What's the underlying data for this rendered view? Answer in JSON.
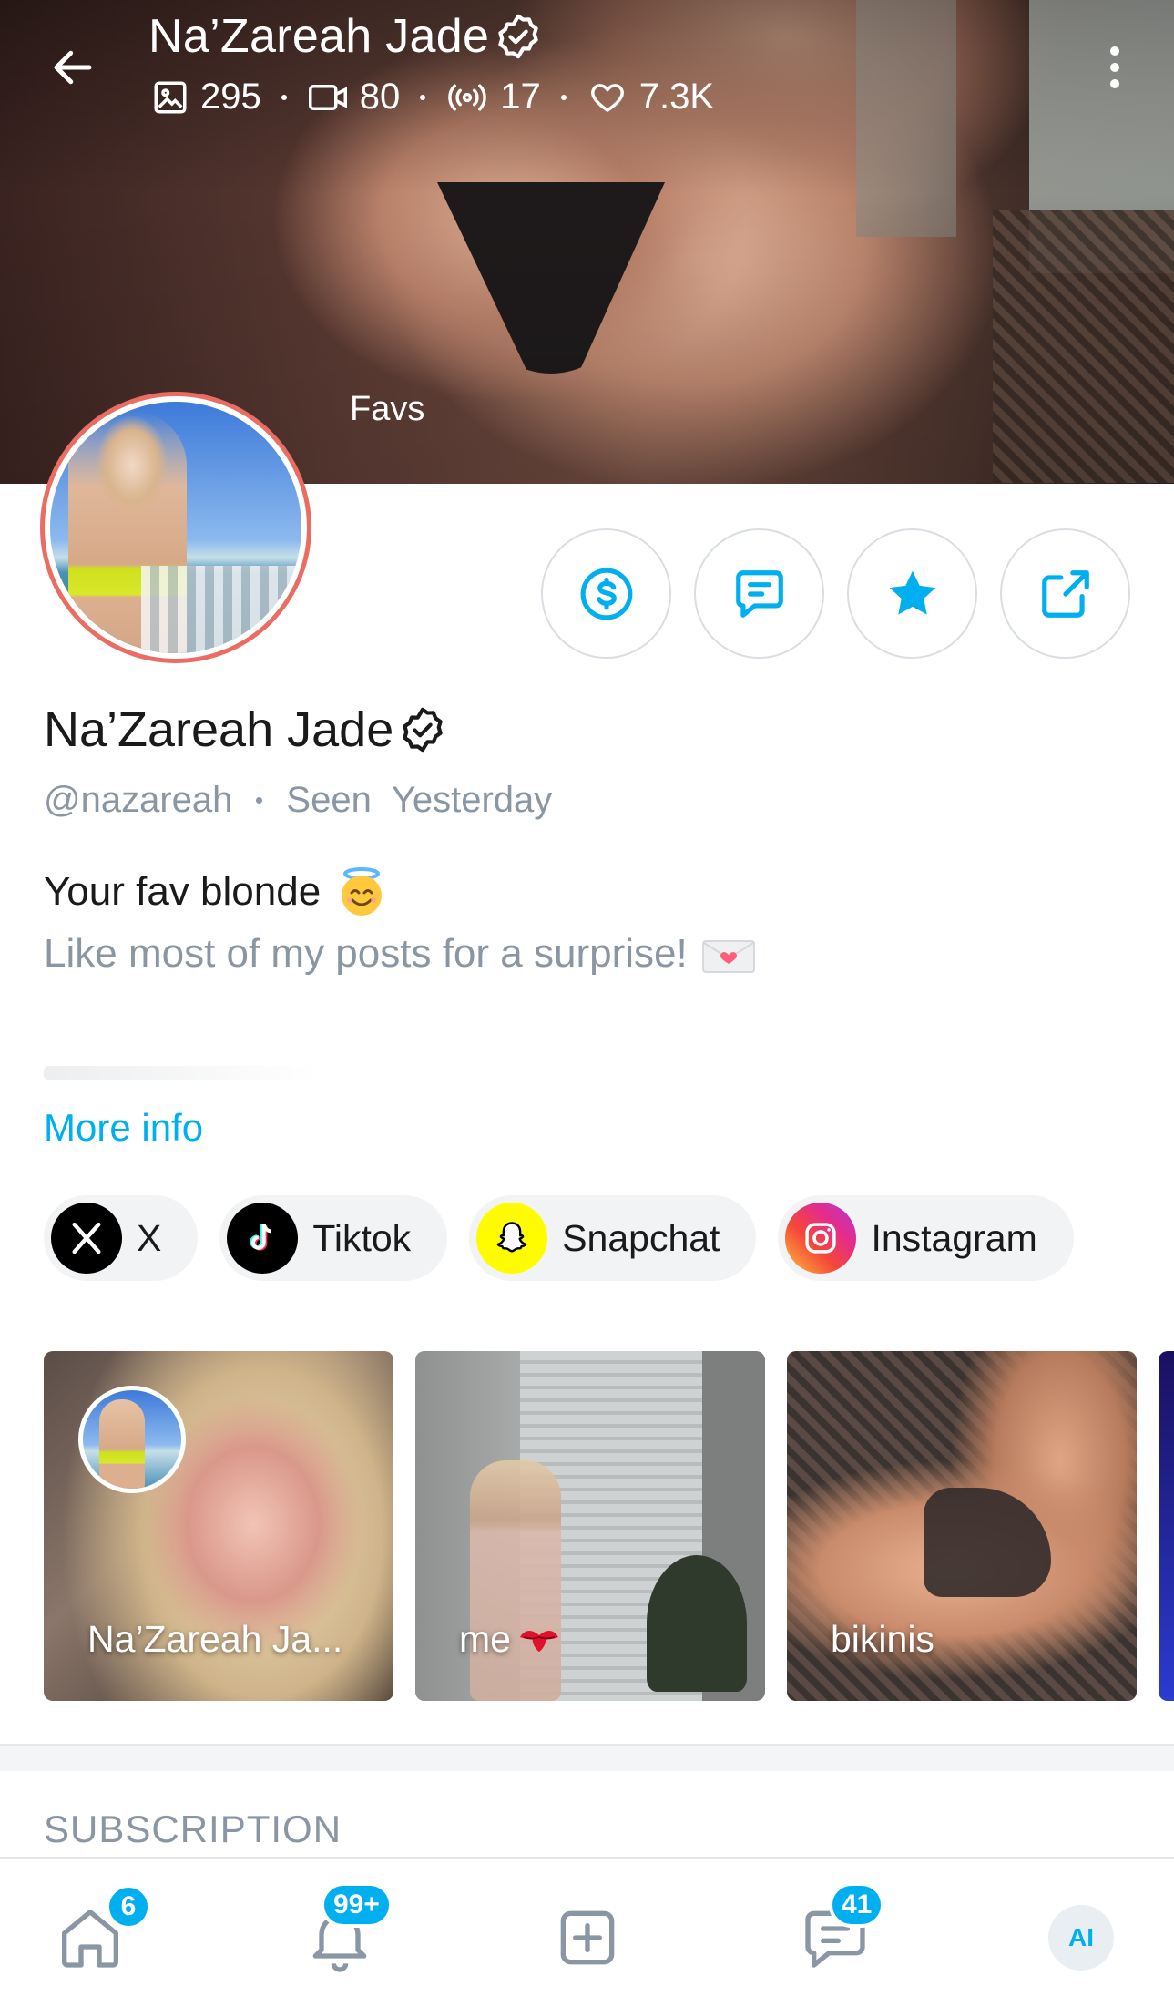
{
  "header": {
    "title": "Na’Zareah Jade",
    "stats": {
      "photos": "295",
      "videos": "80",
      "streams": "17",
      "likes": "7.3K"
    },
    "cover_label": "Favs"
  },
  "profile": {
    "name": "Na’Zareah Jade",
    "handle": "@nazareah",
    "seen_label": "Seen",
    "seen_value": "Yesterday",
    "bio_line1": "Your fav blonde",
    "bio_line2": "Like most of my posts for a surprise!",
    "more_info": "More info"
  },
  "socials": [
    {
      "label": "X",
      "icon": "x-logo-icon"
    },
    {
      "label": "Tiktok",
      "icon": "tiktok-icon"
    },
    {
      "label": "Snapchat",
      "icon": "snapchat-icon"
    },
    {
      "label": "Instagram",
      "icon": "instagram-icon"
    }
  ],
  "highlights": [
    {
      "label": "Na’Zareah Ja..."
    },
    {
      "label": "me"
    },
    {
      "label": "bikinis"
    }
  ],
  "sections": {
    "subscription": "SUBSCRIPTION"
  },
  "nav": {
    "home_badge": "6",
    "notifications_badge": "99+",
    "messages_badge": "41",
    "ai_label": "AI"
  },
  "colors": {
    "accent": "#00aff0",
    "avatar_ring": "#ea6d63",
    "muted_text": "#8a96a3"
  }
}
